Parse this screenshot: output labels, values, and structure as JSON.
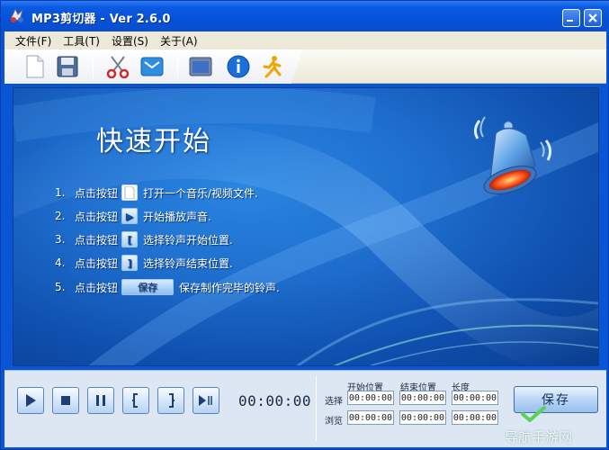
{
  "window": {
    "title": "MP3剪切器 - Ver 2.6.0",
    "min_symbol": "—",
    "close_symbol": "✕"
  },
  "menu": [
    {
      "label": "文件(F)"
    },
    {
      "label": "工具(T)"
    },
    {
      "label": "设置(S)"
    },
    {
      "label": "关于(A)"
    }
  ],
  "toolbar": {
    "icons": [
      "new-file-icon",
      "save-disk-icon",
      "scissors-icon",
      "mail-icon",
      "window-icon",
      "info-icon",
      "runner-icon"
    ]
  },
  "main": {
    "title": "快速开始",
    "step_prefix": "点击按钮",
    "steps": [
      {
        "num": "1.",
        "icon": "doc",
        "icon_text": "",
        "desc": "打开一个音乐/视频文件."
      },
      {
        "num": "2.",
        "icon": "play",
        "icon_text": "▶",
        "desc": "开始播放声音."
      },
      {
        "num": "3.",
        "icon": "start-bracket",
        "icon_text": "[",
        "desc": "选择铃声开始位置."
      },
      {
        "num": "4.",
        "icon": "end-bracket",
        "icon_text": "]",
        "desc": "选择铃声结束位置."
      },
      {
        "num": "5.",
        "icon": "save-button",
        "icon_text": "保存",
        "desc": "保存制作完毕的铃声."
      }
    ]
  },
  "controls": {
    "time": "00:00:00",
    "columns": [
      "开始位置",
      "结束位置",
      "长度"
    ],
    "rows": [
      {
        "label": "选择",
        "values": [
          "00:00:00",
          "00:00:00",
          "00:00:00"
        ]
      },
      {
        "label": "浏览",
        "values": [
          "00:00:00",
          "00:00:00",
          "00:00:00"
        ]
      }
    ],
    "save_label": "保存"
  },
  "watermark": "导航手游网",
  "colors": {
    "title_bar": "#0552d8",
    "panel_blue": "#1f6fcf",
    "menu_bg": "#ece9d8",
    "control_strip": "#dde7f3"
  }
}
